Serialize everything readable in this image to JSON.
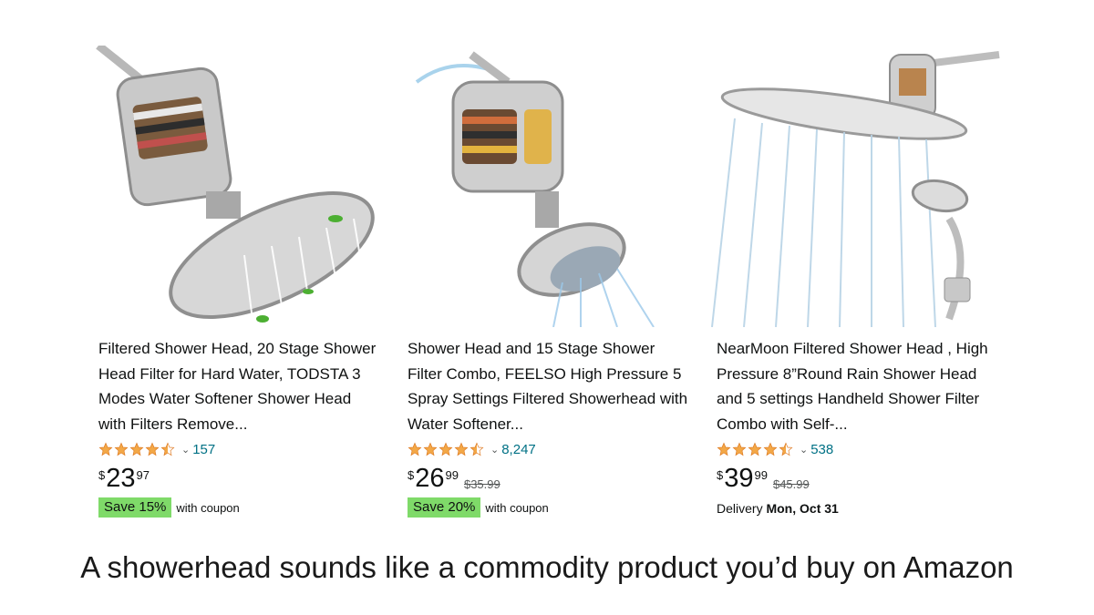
{
  "colors": {
    "star": "#f3a847",
    "link": "#007185",
    "coupon_bg": "#7fda69",
    "image_bg": "#f2f2f2"
  },
  "products": [
    {
      "image_alt": "filter-shower-head-photo",
      "title": "Filtered Shower Head, 20 Stage Shower Head Filter for Hard Water, TODSTA 3 Modes Water Softener Shower Head with Filters Remove...",
      "stars": 4.5,
      "review_count": "157",
      "currency": "$",
      "price_whole": "23",
      "price_fraction": "97",
      "list_price": "",
      "coupon": "Save 15%",
      "coupon_suffix": "with coupon",
      "delivery_label": "",
      "delivery_date": ""
    },
    {
      "image_alt": "shower-filter-combo-photo",
      "title": "Shower Head and 15 Stage Shower Filter Combo, FEELSO High Pressure 5 Spray Settings Filtered Showerhead with Water Softener...",
      "stars": 4.5,
      "review_count": "8,247",
      "currency": "$",
      "price_whole": "26",
      "price_fraction": "99",
      "list_price": "$35.99",
      "coupon": "Save 20%",
      "coupon_suffix": "with coupon",
      "delivery_label": "",
      "delivery_date": ""
    },
    {
      "image_alt": "rain-shower-head-photo",
      "title": "NearMoon Filtered Shower Head , High Pressure 8”Round Rain Shower Head and 5 settings Handheld Shower Filter Combo with Self-...",
      "stars": 4.5,
      "review_count": "538",
      "currency": "$",
      "price_whole": "39",
      "price_fraction": "99",
      "list_price": "$45.99",
      "coupon": "",
      "coupon_suffix": "",
      "delivery_label": "Delivery",
      "delivery_date": "Mon, Oct 31"
    }
  ],
  "caption": "A showerhead sounds like a commodity product you’d buy on Amazon"
}
